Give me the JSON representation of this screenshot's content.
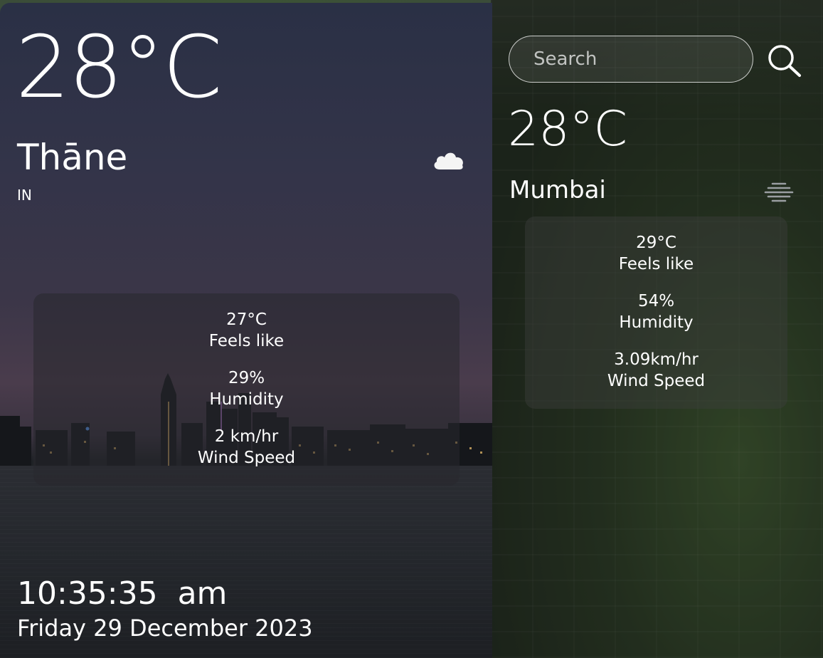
{
  "current": {
    "temperature": "28°C",
    "city": "Thāne",
    "country": "IN",
    "condition_icon": "cloud-icon",
    "details": [
      {
        "value": "27°C",
        "label": "Feels like"
      },
      {
        "value": "29%",
        "label": "Humidity"
      },
      {
        "value": "2 km/hr",
        "label": "Wind Speed"
      }
    ],
    "time": "10:35:35  am",
    "date": "Friday 29 December 2023"
  },
  "search": {
    "placeholder": "Search",
    "icon": "search-icon",
    "result": {
      "temperature": "28°C",
      "city": "Mumbai",
      "condition_icon": "mist-icon",
      "details": [
        {
          "value": "29°C",
          "label": "Feels like"
        },
        {
          "value": "54%",
          "label": "Humidity"
        },
        {
          "value": "3.09km/hr",
          "label": "Wind Speed"
        }
      ]
    }
  }
}
